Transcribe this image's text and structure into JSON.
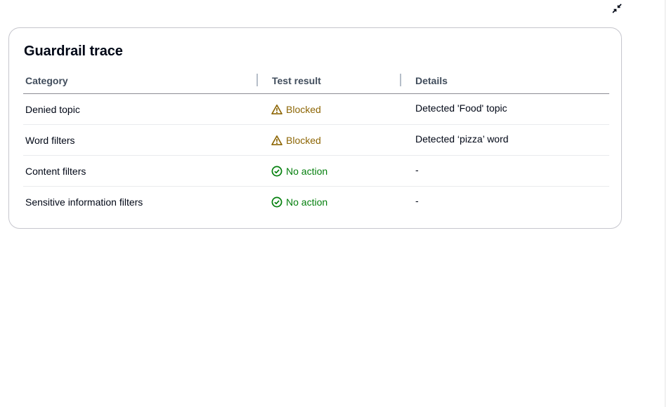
{
  "panel": {
    "title": "Guardrail trace",
    "collapse_icon": "collapse-icon"
  },
  "table": {
    "columns": [
      "Category",
      "Test result",
      "Details"
    ],
    "rows": [
      {
        "category": "Denied topic",
        "result": "Blocked",
        "status": "blocked",
        "icon": "warning-icon",
        "details": "Detected 'Food' topic"
      },
      {
        "category": "Word filters",
        "result": "Blocked",
        "status": "blocked",
        "icon": "warning-icon",
        "details": "Detected ‘pizza’ word"
      },
      {
        "category": "Content filters",
        "result": "No action",
        "status": "ok",
        "icon": "check-circle-icon",
        "details": "-"
      },
      {
        "category": "Sensitive information filters",
        "result": "No action",
        "status": "ok",
        "icon": "check-circle-icon",
        "details": "-"
      }
    ]
  },
  "colors": {
    "blocked": "#8d6605",
    "ok": "#037f0c",
    "border": "#c6c6cd"
  }
}
